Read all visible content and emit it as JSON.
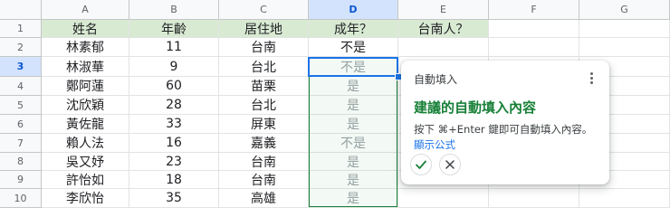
{
  "columns": [
    "A",
    "B",
    "C",
    "D",
    "E",
    "F",
    "G"
  ],
  "header_row": {
    "num": "1",
    "cells": [
      "姓名",
      "年齡",
      "居住地",
      "成年？",
      "台南人？",
      "",
      ""
    ]
  },
  "rows": [
    {
      "num": "2",
      "name": "林素郁",
      "age": "11",
      "city": "台南",
      "adult": "不是"
    },
    {
      "num": "3",
      "name": "林淑華",
      "age": "9",
      "city": "台北",
      "adult": "不是"
    },
    {
      "num": "4",
      "name": "鄭阿蓮",
      "age": "60",
      "city": "苗栗",
      "adult": "是"
    },
    {
      "num": "5",
      "name": "沈欣穎",
      "age": "28",
      "city": "台北",
      "adult": "是"
    },
    {
      "num": "6",
      "name": "黃佐龍",
      "age": "33",
      "city": "屏東",
      "adult": "是"
    },
    {
      "num": "7",
      "name": "賴人法",
      "age": "16",
      "city": "嘉義",
      "adult": "不是"
    },
    {
      "num": "8",
      "name": "吳又妤",
      "age": "23",
      "city": "台南",
      "adult": "是"
    },
    {
      "num": "9",
      "name": "許怡如",
      "age": "18",
      "city": "台南",
      "adult": "是"
    },
    {
      "num": "10",
      "name": "李欣怡",
      "age": "35",
      "city": "高雄",
      "adult": "是"
    }
  ],
  "popup": {
    "title": "自動填入",
    "heading": "建議的自動填入內容",
    "body": "按下 ⌘+Enter 鍵即可自動填入內容。",
    "link": "顯示公式"
  }
}
